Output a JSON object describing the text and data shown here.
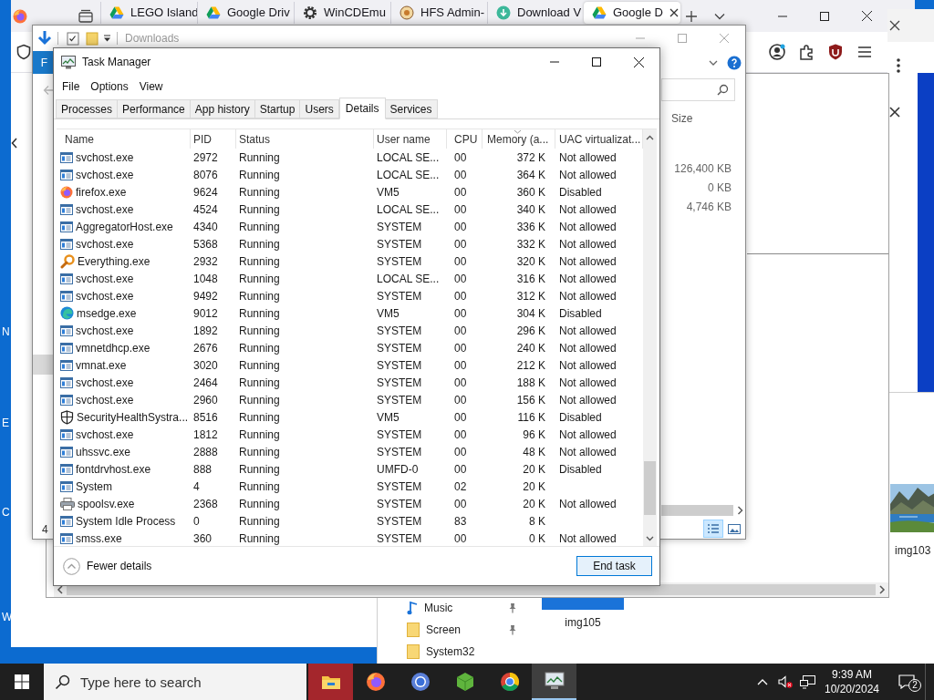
{
  "desktop_icon_labels": [
    "N",
    "E",
    "C",
    "W"
  ],
  "browser": {
    "tabs": [
      {
        "title": "LEGO Island",
        "kind": "drive",
        "selected": false
      },
      {
        "title": "Google Driv",
        "kind": "drive",
        "selected": false
      },
      {
        "title": "WinCDEmu",
        "kind": "gear",
        "selected": false
      },
      {
        "title": "HFS Admin-",
        "kind": "disc",
        "selected": false
      },
      {
        "title": "Download V",
        "kind": "download",
        "selected": false
      },
      {
        "title": "Google D",
        "kind": "drive",
        "selected": true
      }
    ]
  },
  "explorer_downloads": {
    "title": "Downloads",
    "ribbon_tab": "F",
    "size_column": "Size",
    "sizes": [
      "126,400 KB",
      "0 KB",
      "4,746 KB"
    ],
    "status": "4"
  },
  "explorer_back": {
    "nav_items": [
      {
        "label": "Music",
        "kind": "music",
        "pinned": true
      },
      {
        "label": "Screen",
        "kind": "folder",
        "pinned": true
      },
      {
        "label": "System32",
        "kind": "folder",
        "pinned": false
      }
    ],
    "files": [
      {
        "label": "img105"
      },
      {
        "label": "img103"
      }
    ]
  },
  "task_manager": {
    "title": "Task Manager",
    "menu": [
      "File",
      "Options",
      "View"
    ],
    "tabs": [
      {
        "label": "Processes",
        "selected": false
      },
      {
        "label": "Performance",
        "selected": false
      },
      {
        "label": "App history",
        "selected": false
      },
      {
        "label": "Startup",
        "selected": false
      },
      {
        "label": "Users",
        "selected": false
      },
      {
        "label": "Details",
        "selected": true
      },
      {
        "label": "Services",
        "selected": false
      }
    ],
    "columns": [
      "Name",
      "PID",
      "Status",
      "User name",
      "CPU",
      "Memory (a...",
      "UAC virtualizat..."
    ],
    "rows": [
      {
        "kind": "service",
        "name": "svchost.exe",
        "pid": "2972",
        "status": "Running",
        "user": "LOCAL SE...",
        "cpu": "00",
        "memory": "372 K",
        "uac": "Not allowed"
      },
      {
        "kind": "service",
        "name": "svchost.exe",
        "pid": "8076",
        "status": "Running",
        "user": "LOCAL SE...",
        "cpu": "00",
        "memory": "364 K",
        "uac": "Not allowed"
      },
      {
        "kind": "fox",
        "name": "firefox.exe",
        "pid": "9624",
        "status": "Running",
        "user": "VM5",
        "cpu": "00",
        "memory": "360 K",
        "uac": "Disabled"
      },
      {
        "kind": "service",
        "name": "svchost.exe",
        "pid": "4524",
        "status": "Running",
        "user": "LOCAL SE...",
        "cpu": "00",
        "memory": "340 K",
        "uac": "Not allowed"
      },
      {
        "kind": "service",
        "name": "AggregatorHost.exe",
        "pid": "4340",
        "status": "Running",
        "user": "SYSTEM",
        "cpu": "00",
        "memory": "336 K",
        "uac": "Not allowed"
      },
      {
        "kind": "service",
        "name": "svchost.exe",
        "pid": "5368",
        "status": "Running",
        "user": "SYSTEM",
        "cpu": "00",
        "memory": "332 K",
        "uac": "Not allowed"
      },
      {
        "kind": "magnifier",
        "name": "Everything.exe",
        "pid": "2932",
        "status": "Running",
        "user": "SYSTEM",
        "cpu": "00",
        "memory": "320 K",
        "uac": "Not allowed"
      },
      {
        "kind": "service",
        "name": "svchost.exe",
        "pid": "1048",
        "status": "Running",
        "user": "LOCAL SE...",
        "cpu": "00",
        "memory": "316 K",
        "uac": "Not allowed"
      },
      {
        "kind": "service",
        "name": "svchost.exe",
        "pid": "9492",
        "status": "Running",
        "user": "SYSTEM",
        "cpu": "00",
        "memory": "312 K",
        "uac": "Not allowed"
      },
      {
        "kind": "swirl",
        "name": "msedge.exe",
        "pid": "9012",
        "status": "Running",
        "user": "VM5",
        "cpu": "00",
        "memory": "304 K",
        "uac": "Disabled"
      },
      {
        "kind": "service",
        "name": "svchost.exe",
        "pid": "1892",
        "status": "Running",
        "user": "SYSTEM",
        "cpu": "00",
        "memory": "296 K",
        "uac": "Not allowed"
      },
      {
        "kind": "service",
        "name": "vmnetdhcp.exe",
        "pid": "2676",
        "status": "Running",
        "user": "SYSTEM",
        "cpu": "00",
        "memory": "240 K",
        "uac": "Not allowed"
      },
      {
        "kind": "service",
        "name": "vmnat.exe",
        "pid": "3020",
        "status": "Running",
        "user": "SYSTEM",
        "cpu": "00",
        "memory": "212 K",
        "uac": "Not allowed"
      },
      {
        "kind": "service",
        "name": "svchost.exe",
        "pid": "2464",
        "status": "Running",
        "user": "SYSTEM",
        "cpu": "00",
        "memory": "188 K",
        "uac": "Not allowed"
      },
      {
        "kind": "service",
        "name": "svchost.exe",
        "pid": "2960",
        "status": "Running",
        "user": "SYSTEM",
        "cpu": "00",
        "memory": "156 K",
        "uac": "Not allowed"
      },
      {
        "kind": "shield",
        "name": "SecurityHealthSystra...",
        "pid": "8516",
        "status": "Running",
        "user": "VM5",
        "cpu": "00",
        "memory": "116 K",
        "uac": "Disabled"
      },
      {
        "kind": "service",
        "name": "svchost.exe",
        "pid": "1812",
        "status": "Running",
        "user": "SYSTEM",
        "cpu": "00",
        "memory": "96 K",
        "uac": "Not allowed"
      },
      {
        "kind": "service",
        "name": "uhssvc.exe",
        "pid": "2888",
        "status": "Running",
        "user": "SYSTEM",
        "cpu": "00",
        "memory": "48 K",
        "uac": "Not allowed"
      },
      {
        "kind": "service",
        "name": "fontdrvhost.exe",
        "pid": "888",
        "status": "Running",
        "user": "UMFD-0",
        "cpu": "00",
        "memory": "20 K",
        "uac": "Disabled"
      },
      {
        "kind": "service",
        "name": "System",
        "pid": "4",
        "status": "Running",
        "user": "SYSTEM",
        "cpu": "02",
        "memory": "20 K"
      },
      {
        "kind": "printer",
        "name": "spoolsv.exe",
        "pid": "2368",
        "status": "Running",
        "user": "SYSTEM",
        "cpu": "00",
        "memory": "20 K",
        "uac": "Not allowed"
      },
      {
        "kind": "service",
        "name": "System Idle Process",
        "pid": "0",
        "status": "Running",
        "user": "SYSTEM",
        "cpu": "83",
        "memory": "8 K"
      },
      {
        "kind": "service",
        "name": "smss.exe",
        "pid": "360",
        "status": "Running",
        "user": "SYSTEM",
        "cpu": "00",
        "memory": "0 K",
        "uac": "Not allowed"
      }
    ],
    "fewer_details": "Fewer details",
    "end_task": "End task"
  },
  "taskbar": {
    "search_placeholder": "Type here to search",
    "apps": [
      {
        "kind": "folder",
        "active": false
      },
      {
        "kind": "fox",
        "active": false
      },
      {
        "kind": "ring",
        "active": false
      },
      {
        "kind": "cube",
        "active": false
      },
      {
        "kind": "wheel",
        "active": false
      },
      {
        "kind": "monitor",
        "active": true
      }
    ],
    "time": "9:39 AM",
    "date": "10/20/2024",
    "notifications": "2"
  }
}
